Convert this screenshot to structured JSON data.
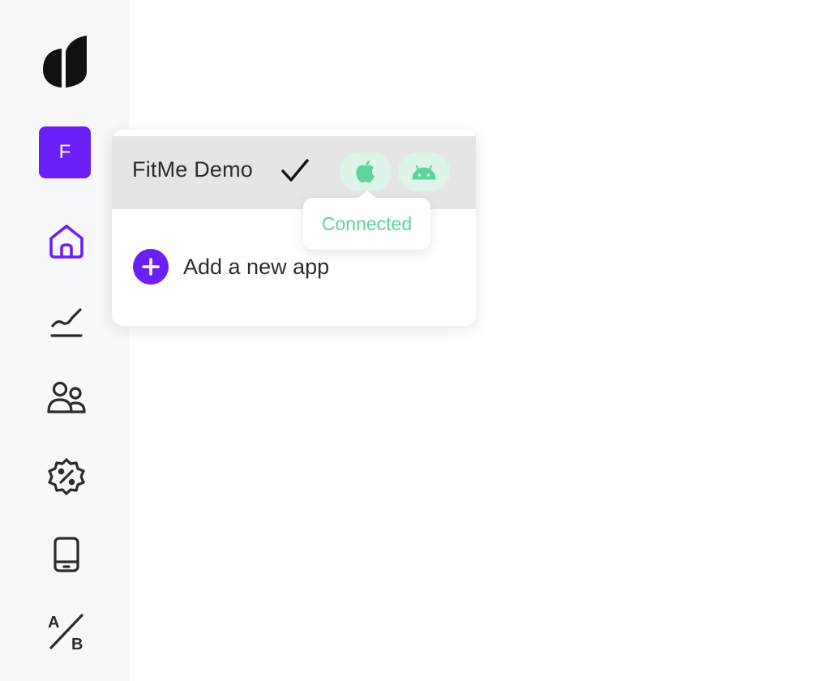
{
  "colors": {
    "accent": "#6b1ff7",
    "connected_green": "#5dd39e",
    "pill_bg": "#def4e8",
    "icon_dark": "#2b2b2b"
  },
  "sidebar": {
    "logo_icon": "leaf-logo-icon",
    "app_avatar": "F",
    "nav": [
      {
        "icon": "home-icon",
        "active": true
      },
      {
        "icon": "analytics-chart-icon",
        "active": false
      },
      {
        "icon": "users-icon",
        "active": false
      },
      {
        "icon": "discount-badge-icon",
        "active": false
      },
      {
        "icon": "mobile-device-icon",
        "active": false
      },
      {
        "icon": "ab-test-icon",
        "active": false
      }
    ]
  },
  "app_switcher": {
    "selected_app": {
      "name": "FitMe Demo",
      "selected_icon": "checkmark-icon",
      "platforms": [
        {
          "icon": "apple-icon",
          "status": "Connected"
        },
        {
          "icon": "android-icon"
        }
      ]
    },
    "tooltip": "Connected",
    "add_app_label": "Add a new app",
    "add_app_icon": "plus-circle-icon"
  }
}
